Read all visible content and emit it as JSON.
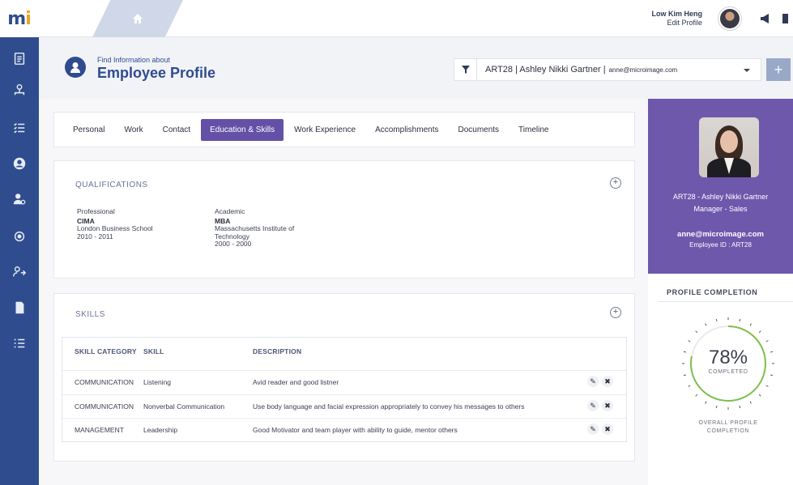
{
  "app": {
    "logo": {
      "m": "m",
      "i": "i"
    }
  },
  "topbar": {
    "user_name": "Low Kim Heng",
    "edit_profile": "Edit Profile"
  },
  "header": {
    "subtitle": "Find Information about",
    "title": "Employee Profile",
    "employee_select": {
      "value": "ART28 | Ashley Nikki Gartner |",
      "email": "anne@microimage.com"
    },
    "add_label": "+"
  },
  "tabs": [
    {
      "label": "Personal",
      "active": false
    },
    {
      "label": "Work",
      "active": false
    },
    {
      "label": "Contact",
      "active": false
    },
    {
      "label": "Education & Skills",
      "active": true
    },
    {
      "label": "Work Experience",
      "active": false
    },
    {
      "label": "Accomplishments",
      "active": false
    },
    {
      "label": "Documents",
      "active": false
    },
    {
      "label": "Timeline",
      "active": false
    }
  ],
  "qualifications": {
    "title": "QUALIFICATIONS",
    "add": "+",
    "items": [
      {
        "kind": "Professional",
        "degree": "CIMA",
        "institution": "London Business School",
        "years": "2010 - 2011"
      },
      {
        "kind": "Academic",
        "degree": "MBA",
        "institution": "Massachusetts Institute of Technology",
        "years": "2000 - 2000"
      }
    ]
  },
  "skills": {
    "title": "SKILLS",
    "add": "+",
    "headers": {
      "category": "SKILL CATEGORY",
      "skill": "SKILL",
      "description": "DESCRIPTION"
    },
    "rows": [
      {
        "category": "COMMUNICATION",
        "skill": "Listening",
        "description": "Avid reader and good listner"
      },
      {
        "category": "COMMUNICATION",
        "skill": "Nonverbal Communication",
        "description": "Use body language and facial expression appropriately to convey his messages to others"
      },
      {
        "category": "MANAGEMENT",
        "skill": "Leadership",
        "description": "Good Motivator and team player with ability to guide, mentor others"
      }
    ],
    "edit_glyph": "✎",
    "delete_glyph": "✖"
  },
  "profile_card": {
    "id_name": "ART28 - Ashley Nikki Gartner",
    "role": "Manager - Sales",
    "email": "anne@microimage.com",
    "employee_id": "Employee ID : ART28"
  },
  "completion": {
    "title": "PROFILE COMPLETION",
    "percent_text": "78%",
    "percent_value": 78,
    "completed_label": "COMPLETED",
    "overall_line1": "OVERALL PROFILE",
    "overall_line2": "COMPLETION",
    "ring_color": "#7cc04a"
  },
  "sidebar": {
    "icons": [
      "clipboard-icon",
      "org-chart-icon",
      "list-check-icon",
      "user-circle-icon",
      "user-gear-icon",
      "target-icon",
      "user-switch-icon",
      "document-icon",
      "list-icon"
    ]
  }
}
